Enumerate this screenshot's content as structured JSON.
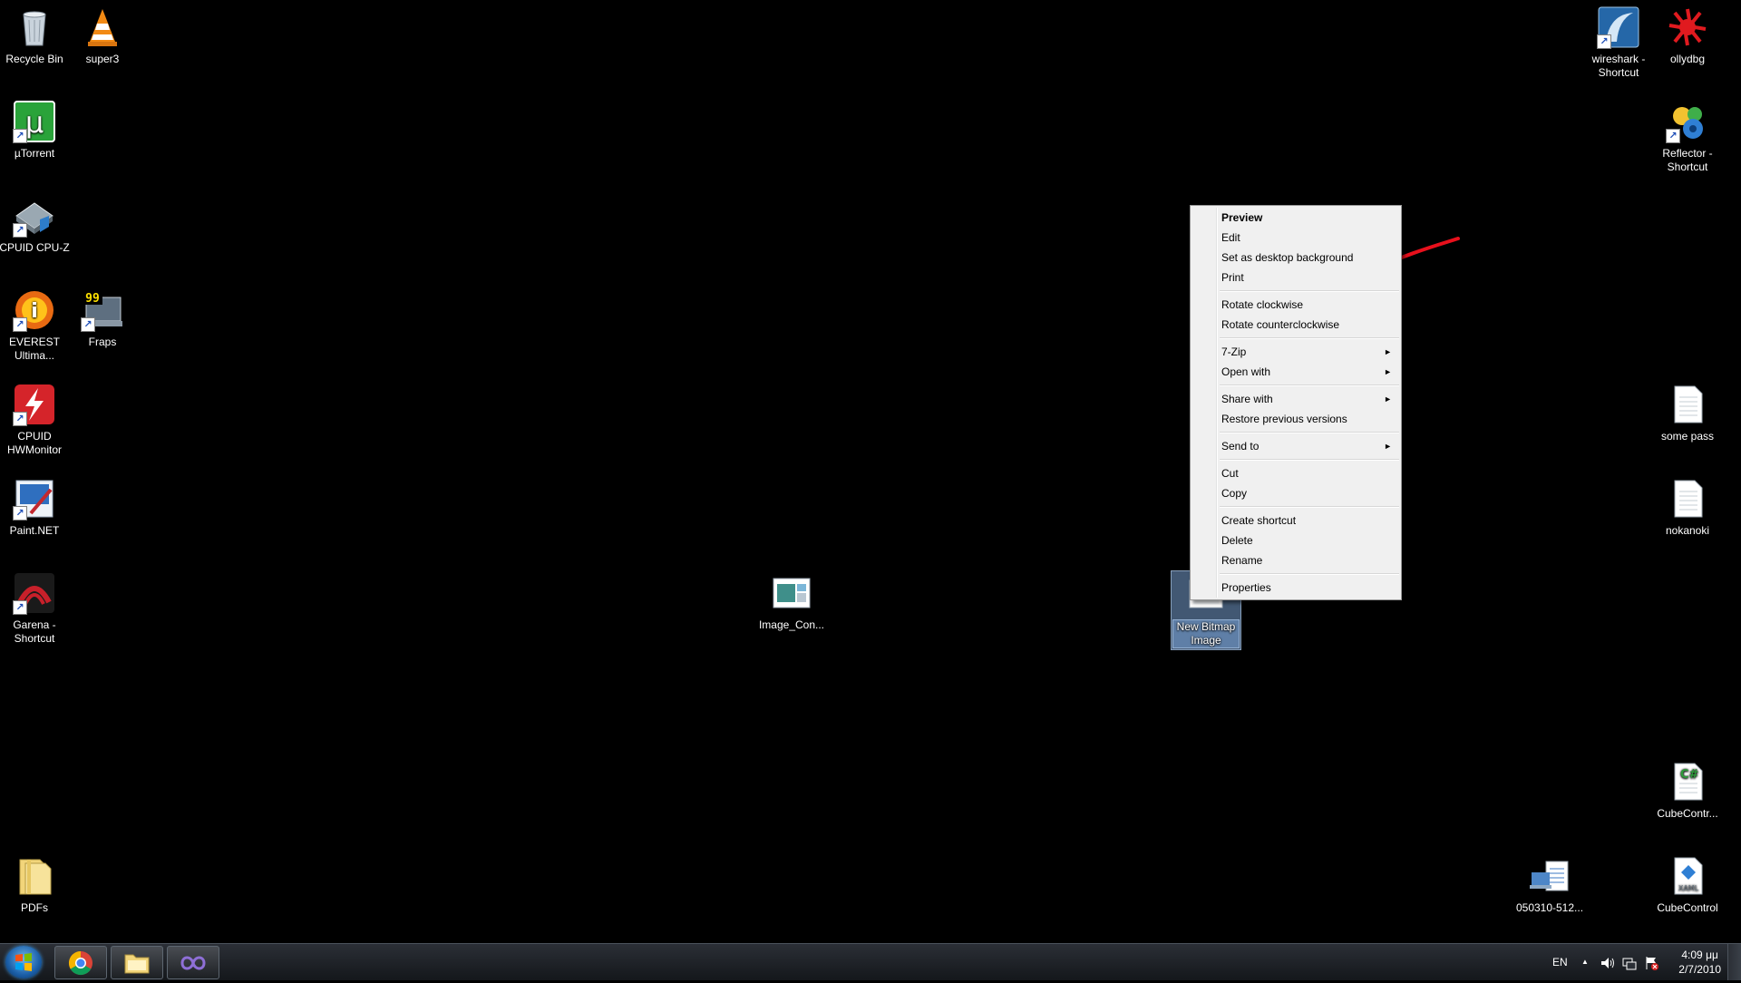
{
  "desktop_icons": [
    {
      "id": "recycle-bin",
      "label": "Recycle Bin",
      "icon": "recycle-bin-icon",
      "shortcut": false
    },
    {
      "id": "super3",
      "label": "super3",
      "icon": "vlc-cone-icon",
      "shortcut": false
    },
    {
      "id": "utorrent",
      "label": "µTorrent",
      "icon": "utorrent-icon",
      "shortcut": true
    },
    {
      "id": "cpuz",
      "label": "CPUID CPU-Z",
      "icon": "cpuz-icon",
      "shortcut": true
    },
    {
      "id": "everest",
      "label": "EVEREST\nUltima...",
      "icon": "everest-icon",
      "shortcut": true
    },
    {
      "id": "fraps",
      "label": "Fraps",
      "icon": "fraps-icon",
      "shortcut": true
    },
    {
      "id": "hwmonitor",
      "label": "CPUID\nHWMonitor",
      "icon": "hwmonitor-icon",
      "shortcut": true
    },
    {
      "id": "paintnet",
      "label": "Paint.NET",
      "icon": "paintnet-icon",
      "shortcut": true
    },
    {
      "id": "garena",
      "label": "Garena -\nShortcut",
      "icon": "garena-icon",
      "shortcut": true
    },
    {
      "id": "pdfs",
      "label": "PDFs",
      "icon": "folder-icon",
      "shortcut": false
    },
    {
      "id": "image-con",
      "label": "Image_Con...",
      "icon": "image-file-icon",
      "shortcut": false
    },
    {
      "id": "new-bitmap",
      "label": "New Bitmap\nImage",
      "icon": "bitmap-file-icon",
      "shortcut": false,
      "selected": true
    },
    {
      "id": "wireshark",
      "label": "wireshark -\nShortcut",
      "icon": "wireshark-icon",
      "shortcut": true
    },
    {
      "id": "ollydbg",
      "label": "ollydbg",
      "icon": "ollydbg-icon",
      "shortcut": false
    },
    {
      "id": "reflector",
      "label": "Reflector -\nShortcut",
      "icon": "reflector-icon",
      "shortcut": true
    },
    {
      "id": "some-pass",
      "label": "some pass",
      "icon": "text-file-icon",
      "shortcut": false
    },
    {
      "id": "nokanoki",
      "label": "nokanoki",
      "icon": "text-file-icon",
      "shortcut": false
    },
    {
      "id": "cubecontr",
      "label": "CubeContr...",
      "icon": "csharp-file-icon",
      "shortcut": false
    },
    {
      "id": "cubecontrol",
      "label": "CubeControl",
      "icon": "xaml-file-icon",
      "shortcut": false
    },
    {
      "id": "doc-050310",
      "label": "050310-512...",
      "icon": "document-icon",
      "shortcut": false
    }
  ],
  "context_menu": {
    "groups": [
      [
        {
          "label": "Preview",
          "bold": true
        },
        {
          "label": "Edit"
        },
        {
          "label": "Set as desktop background"
        },
        {
          "label": "Print"
        }
      ],
      [
        {
          "label": "Rotate clockwise"
        },
        {
          "label": "Rotate counterclockwise"
        }
      ],
      [
        {
          "label": "7-Zip",
          "submenu": true
        },
        {
          "label": "Open with",
          "submenu": true
        }
      ],
      [
        {
          "label": "Share with",
          "submenu": true
        },
        {
          "label": "Restore previous versions"
        }
      ],
      [
        {
          "label": "Send to",
          "submenu": true
        }
      ],
      [
        {
          "label": "Cut"
        },
        {
          "label": "Copy"
        }
      ],
      [
        {
          "label": "Create shortcut"
        },
        {
          "label": "Delete"
        },
        {
          "label": "Rename"
        }
      ],
      [
        {
          "label": "Properties"
        }
      ]
    ],
    "submenu_arrow": "►"
  },
  "annotation": {
    "color": "#e8101c",
    "icon": "red-arrow-annotation"
  },
  "taskbar": {
    "pinned": [
      {
        "id": "chrome",
        "icon": "chrome-icon"
      },
      {
        "id": "explorer",
        "icon": "explorer-folder-icon"
      },
      {
        "id": "visual-studio",
        "icon": "visual-studio-icon"
      }
    ],
    "language": "EN",
    "tray_up_arrow": "▲",
    "clock_time": "4:09 μμ",
    "clock_date": "2/7/2010"
  },
  "colors": {
    "desktop_bg": "#000000",
    "selection": "#7aa0d2",
    "menu_bg": "#f0f0f0"
  }
}
